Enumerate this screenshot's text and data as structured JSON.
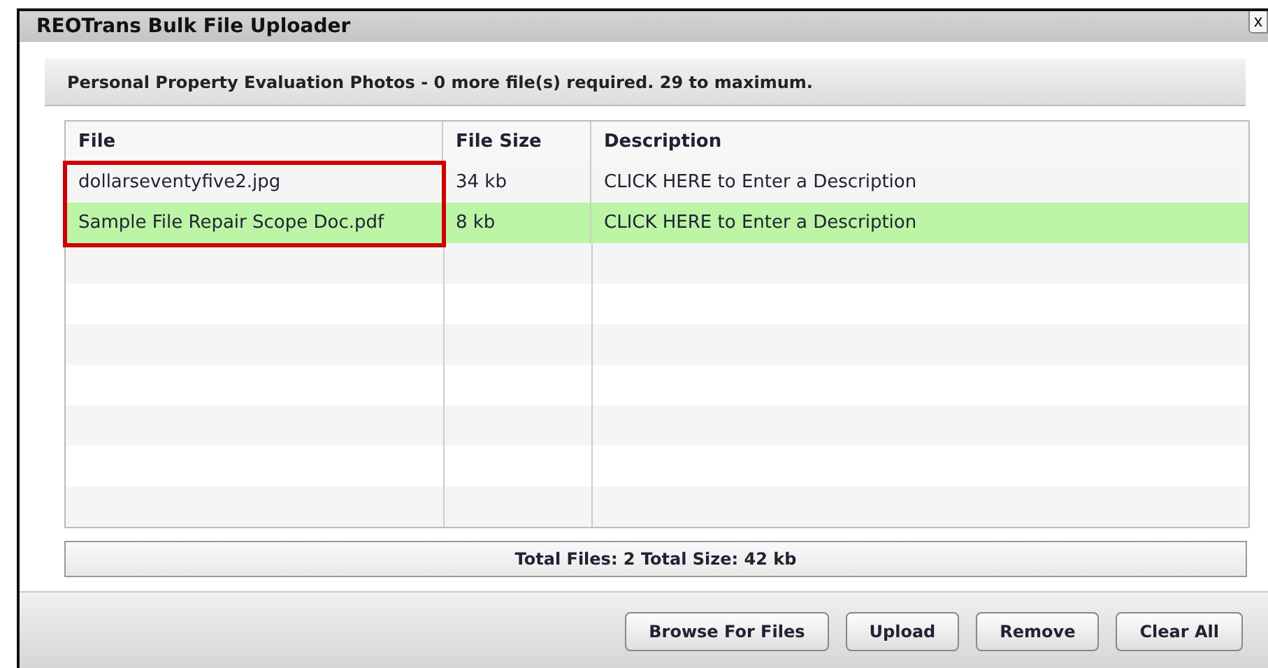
{
  "window": {
    "title": "REOTrans Bulk File Uploader",
    "close": "x"
  },
  "header": "Personal Property Evaluation Photos - 0 more file(s) required. 29 to maximum.",
  "table": {
    "columns": [
      "File",
      "File Size",
      "Description"
    ],
    "rows": [
      {
        "file": "dollarseventyfive2.jpg",
        "size": "34 kb",
        "description": "CLICK HERE to Enter a Description",
        "selected": false
      },
      {
        "file": "Sample File Repair Scope Doc.pdf",
        "size": "8 kb",
        "description": "CLICK HERE to Enter a Description",
        "selected": true
      }
    ]
  },
  "totals": "Total Files: 2 Total Size: 42 kb",
  "buttons": [
    "Browse For Files",
    "Upload",
    "Remove",
    "Clear All"
  ]
}
